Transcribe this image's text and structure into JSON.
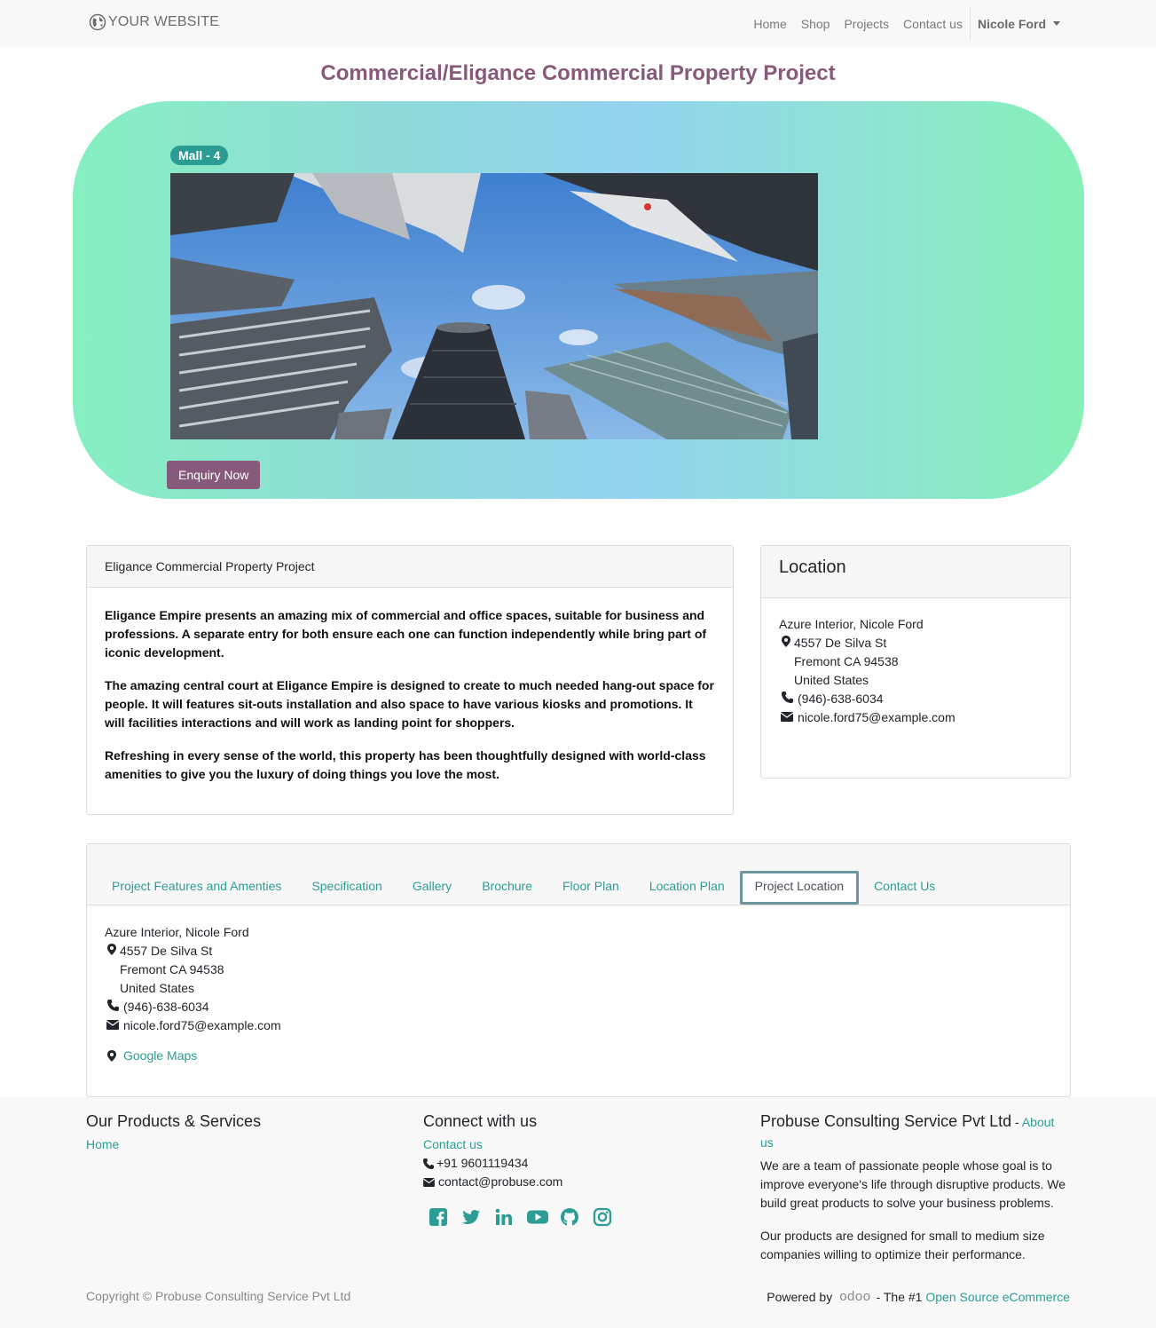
{
  "navbar": {
    "brand": "YOUR WEBSITE",
    "links": [
      "Home",
      "Shop",
      "Projects",
      "Contact us"
    ],
    "user": "Nicole Ford"
  },
  "page_title": "Commercial/Eligance Commercial Property Project",
  "hero": {
    "badge": "Mall - 4",
    "button": "Enquiry Now"
  },
  "description": {
    "header": "Eligance Commercial Property Project",
    "paragraphs": [
      "Eligance Empire presents an amazing mix of commercial and office spaces, suitable for business and professions. A separate entry for both ensure each one can function independently while bring part of iconic development.",
      "The amazing central court at Eligance Empire is designed to create to much needed hang-out space for people. It will features sit-outs installation and also space to have various kiosks and promotions. It will facilities interactions and will work as landing point for shoppers.",
      "Refreshing in every sense of the world, this property has been thoughtfully designed with world-class amenities to give you the luxury of doing things you love the most."
    ]
  },
  "location": {
    "header": "Location",
    "name": "Azure Interior, Nicole Ford",
    "street": "4557 De Silva St",
    "city": "Fremont CA 94538",
    "country": "United States",
    "phone": "(946)-638-6034",
    "email": "nicole.ford75@example.com"
  },
  "tabs": {
    "items": [
      "Project Features and Amenties",
      "Specification",
      "Gallery",
      "Brochure",
      "Floor Plan",
      "Location Plan",
      "Project Location",
      "Contact Us"
    ],
    "active": "Project Location",
    "google_maps": "Google Maps"
  },
  "footer": {
    "products_title": "Our Products & Services",
    "products_link": "Home",
    "connect_title": "Connect with us",
    "connect_link": "Contact us",
    "phone": "+91 9601119434",
    "email": "contact@probuse.com",
    "social_icons": [
      "facebook-icon",
      "twitter-icon",
      "linkedin-icon",
      "youtube-icon",
      "github-icon",
      "instagram-icon"
    ],
    "company_title": "Probuse Consulting Service Pvt Ltd",
    "company_sep": " - ",
    "about_link": "About us",
    "about_p1": "We are a team of passionate people whose goal is to improve everyone's life through disruptive products. We build great products to solve your business problems.",
    "about_p2": "Our products are designed for small to medium size companies willing to optimize their performance.",
    "copyright": "Copyright © Probuse Consulting Service Pvt Ltd",
    "powered_by": "Powered by",
    "odoo": "odoo",
    "tagline": "- The #1",
    "ecommerce_link": "Open Source eCommerce"
  },
  "colors": {
    "brand": "#875a7b",
    "accent": "#2c9d94",
    "badge": "#2b9c93"
  }
}
